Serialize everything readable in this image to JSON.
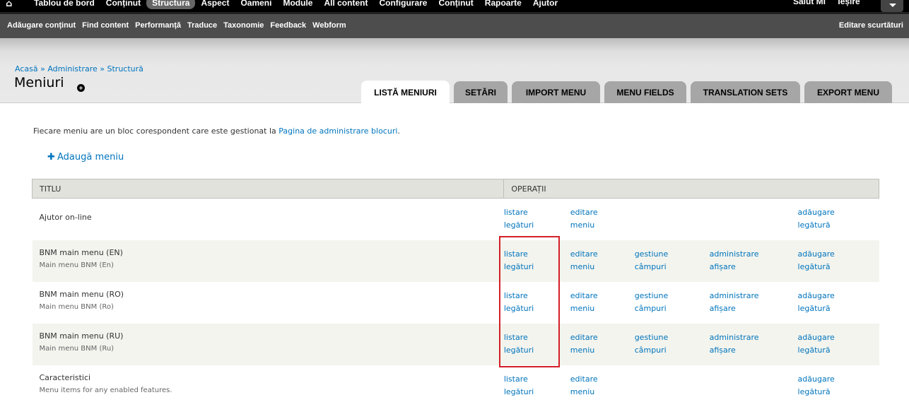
{
  "toolbar": {
    "items": [
      "Tablou de bord",
      "Conținut",
      "Structura",
      "Aspect",
      "Oameni",
      "Module",
      "All content",
      "Configurare",
      "Conținut",
      "Rapoarte",
      "Ajutor"
    ],
    "active_index": 2,
    "user_greeting": "Salut MI",
    "logout": "Ieșire"
  },
  "shortcuts": {
    "items": [
      "Adăugare conținut",
      "Find content",
      "Performanță",
      "Traduce",
      "Taxonomie",
      "Feedback",
      "Webform"
    ],
    "edit_label": "Editare scurtături"
  },
  "breadcrumb": "Acasă » Administrare » Structură",
  "page_title": "Meniuri",
  "tabs": [
    {
      "label": "LISTĂ MENIURI",
      "active": true
    },
    {
      "label": "SETĂRI",
      "active": false
    },
    {
      "label": "IMPORT MENU",
      "active": false
    },
    {
      "label": "MENU FIELDS",
      "active": false
    },
    {
      "label": "TRANSLATION SETS",
      "active": false
    },
    {
      "label": "EXPORT MENU",
      "active": false
    }
  ],
  "intro": {
    "text": "Fiecare meniu are un bloc corespondent care este gestionat la ",
    "link": "Pagina de administrare blocuri",
    "end": "."
  },
  "add_menu": "Adaugă meniu",
  "table": {
    "headers": [
      "TITLU",
      "OPERAȚII"
    ],
    "rows": [
      {
        "title": "Ajutor on-line",
        "description": "",
        "ops": [
          [
            "listare",
            "legături"
          ],
          [
            "editare",
            "meniu"
          ],
          null,
          null,
          [
            "adăugare",
            "legătură"
          ]
        ]
      },
      {
        "title": "BNM main menu (EN)",
        "description": "Main menu BNM (En)",
        "ops": [
          [
            "listare",
            "legături"
          ],
          [
            "editare",
            "meniu"
          ],
          [
            "gestiune",
            "câmpuri"
          ],
          [
            "administrare",
            "afișare"
          ],
          [
            "adăugare",
            "legătură"
          ]
        ]
      },
      {
        "title": "BNM main menu (RO)",
        "description": "Main menu BNM (Ro)",
        "ops": [
          [
            "listare",
            "legături"
          ],
          [
            "editare",
            "meniu"
          ],
          [
            "gestiune",
            "câmpuri"
          ],
          [
            "administrare",
            "afișare"
          ],
          [
            "adăugare",
            "legătură"
          ]
        ]
      },
      {
        "title": "BNM main menu (RU)",
        "description": "Main menu BNM (Ru)",
        "ops": [
          [
            "listare",
            "legături"
          ],
          [
            "editare",
            "meniu"
          ],
          [
            "gestiune",
            "câmpuri"
          ],
          [
            "administrare",
            "afișare"
          ],
          [
            "adăugare",
            "legătură"
          ]
        ]
      },
      {
        "title": "Caracteristici",
        "description": "Menu items for any enabled features.",
        "ops": [
          [
            "listare",
            "legături"
          ],
          [
            "editare",
            "meniu"
          ],
          null,
          null,
          [
            "adăugare",
            "legătură"
          ]
        ]
      }
    ]
  },
  "colors": {
    "link": "#0074bd",
    "highlight_box": "#d32027",
    "toolbar_bg": "#000000",
    "shortcut_bg": "#4d4d4d"
  }
}
